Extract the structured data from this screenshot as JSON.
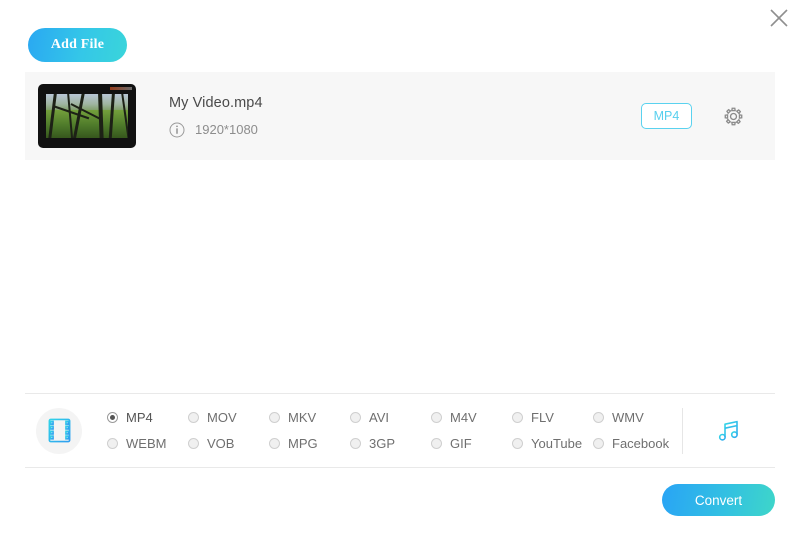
{
  "window": {
    "close_label": "×",
    "close_icon": "close-icon"
  },
  "toolbar": {
    "add_file_label": "Add File"
  },
  "file_list": {
    "items": [
      {
        "name": "My Video.mp4",
        "resolution": "1920*1080",
        "info_icon": "info-circle-icon",
        "output_format_badge": "MP4",
        "settings_icon": "gear-icon",
        "thumbnail_alt": "forest-video-thumbnail"
      }
    ]
  },
  "format_bar": {
    "video_icon": "film-strip-icon",
    "audio_icon": "music-note-icon",
    "selected": "MP4",
    "formats": [
      {
        "label": "MP4",
        "selected": true
      },
      {
        "label": "MOV",
        "selected": false
      },
      {
        "label": "MKV",
        "selected": false
      },
      {
        "label": "AVI",
        "selected": false
      },
      {
        "label": "M4V",
        "selected": false
      },
      {
        "label": "FLV",
        "selected": false
      },
      {
        "label": "WMV",
        "selected": false
      },
      {
        "label": "WEBM",
        "selected": false
      },
      {
        "label": "VOB",
        "selected": false
      },
      {
        "label": "MPG",
        "selected": false
      },
      {
        "label": "3GP",
        "selected": false
      },
      {
        "label": "GIF",
        "selected": false
      },
      {
        "label": "YouTube",
        "selected": false
      },
      {
        "label": "Facebook",
        "selected": false
      }
    ]
  },
  "footer": {
    "convert_label": "Convert"
  },
  "colors": {
    "accent_cyan": "#5ad2ef",
    "gradient_start": "#29a4f5",
    "gradient_end": "#3ed6c9",
    "row_background": "#f7f7f7",
    "divider": "#e9e9e9"
  }
}
